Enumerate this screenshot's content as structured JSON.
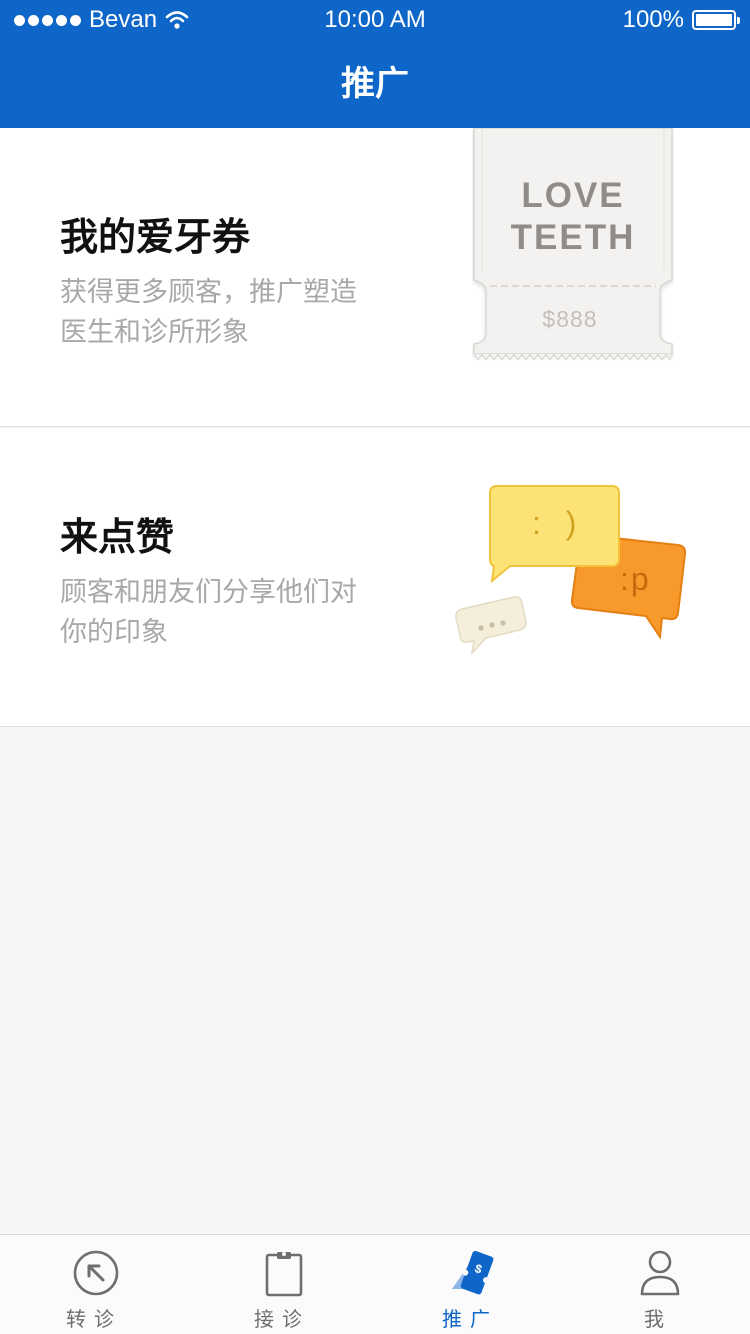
{
  "status_bar": {
    "carrier": "Bevan",
    "time": "10:00 AM",
    "battery": "100%"
  },
  "nav": {
    "title": "推广"
  },
  "cards": [
    {
      "title": "我的爱牙券",
      "description": "获得更多顾客，推广塑造医生和诊所形象",
      "illustration": "ticket",
      "ticket_line1": "LOVE",
      "ticket_line2": "TEETH",
      "ticket_price": "$888"
    },
    {
      "title": "来点赞",
      "description": "顾客和朋友们分享他们对你的印象",
      "illustration": "chat-bubbles",
      "bubble1_text": ": )",
      "bubble2_text": ":p"
    }
  ],
  "tabbar": {
    "active_index": 2,
    "active_color": "#0e66c8",
    "inactive_color": "#6e6e6e",
    "items": [
      {
        "label": "转诊",
        "icon": "referral-arrow-icon"
      },
      {
        "label": "接诊",
        "icon": "clipboard-icon"
      },
      {
        "label": "推广",
        "icon": "promotion-ticket-icon"
      },
      {
        "label": "我",
        "icon": "person-icon"
      }
    ]
  },
  "colors": {
    "brand_blue": "#0e66c8",
    "background": "#f5f6f8"
  }
}
